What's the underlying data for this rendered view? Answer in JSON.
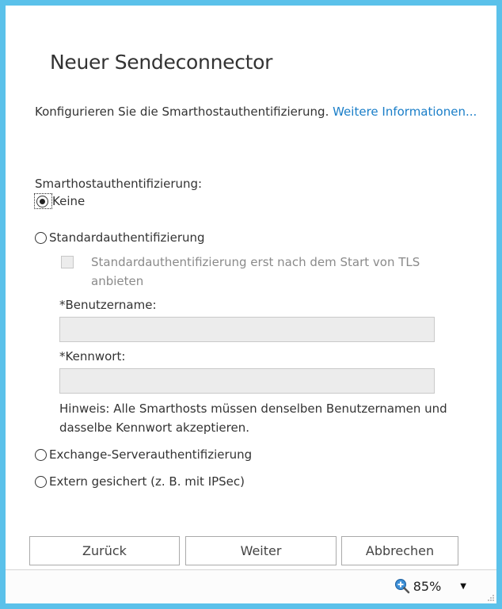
{
  "dialog": {
    "title": "Neuer Sendeconnector",
    "intro_text": "Konfigurieren Sie die Smarthostauthentifizierung. ",
    "intro_link": "Weitere Informationen..."
  },
  "auth": {
    "section_label": "Smarthostauthentifizierung:",
    "options": [
      {
        "label": "Keine",
        "selected": true
      },
      {
        "label": "Standardauthentifizierung",
        "selected": false
      },
      {
        "label": "Exchange-Serverauthentifizierung",
        "selected": false
      },
      {
        "label": "Extern gesichert (z. B. mit IPSec)",
        "selected": false
      }
    ],
    "tls_checkbox_label": "Standardauthentifizierung erst nach dem Start von TLS anbieten",
    "tls_checkbox_checked": false,
    "username_label": "*Benutzername:",
    "username_value": "",
    "password_label": "*Kennwort:",
    "password_value": "",
    "note": "Hinweis: Alle Smarthosts müssen denselben Benutzernamen und dasselbe Kennwort akzeptieren."
  },
  "buttons": {
    "back": "Zurück",
    "next": "Weiter",
    "cancel": "Abbrechen"
  },
  "statusbar": {
    "zoom": "85%",
    "zoom_icon": "zoom-in-icon"
  },
  "colors": {
    "frame": "#5bc1ea",
    "link": "#1a7ec8"
  }
}
